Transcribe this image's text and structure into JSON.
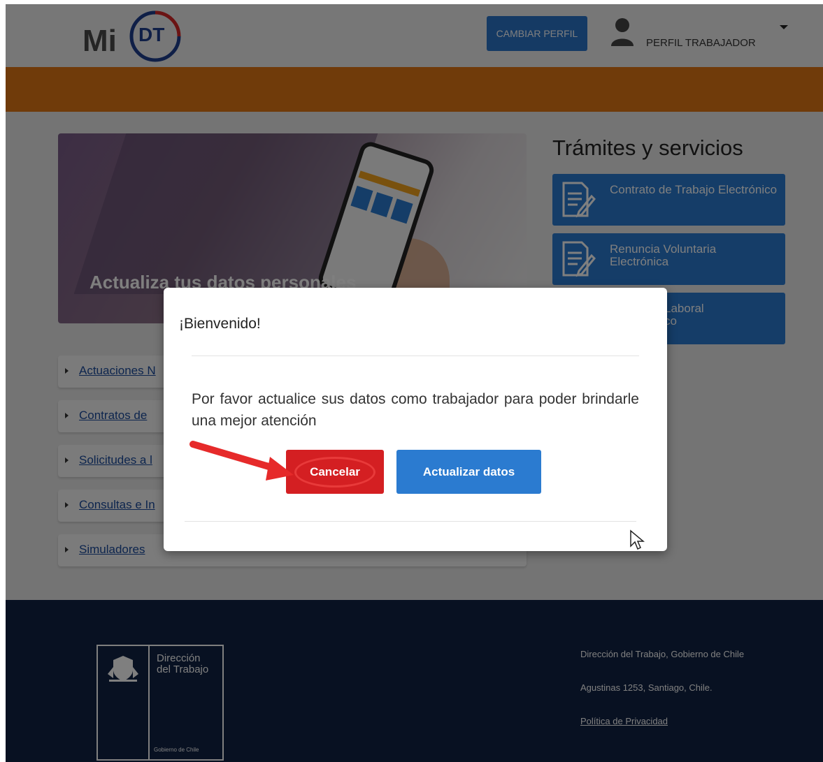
{
  "header": {
    "logo_mi": "Mi",
    "logo_dt": "DT",
    "change_profile_label": "CAMBIAR PERFIL",
    "profile_label": "PERFIL TRABAJADOR"
  },
  "hero": {
    "title": "Actualiza tus datos personales"
  },
  "links": [
    {
      "label": "Actuaciones N"
    },
    {
      "label": "Contratos de"
    },
    {
      "label": "Solicitudes a l"
    },
    {
      "label": "Consultas e In"
    },
    {
      "label": "Simuladores"
    }
  ],
  "services": {
    "title": "Trámites y servicios",
    "items": [
      {
        "label": "Contrato de Trabajo Electrónico"
      },
      {
        "label": "Renuncia Voluntaria Electrónica"
      },
      {
        "label": "Laboral\nco"
      }
    ]
  },
  "footer": {
    "logo_name": "Dirección\ndel Trabajo",
    "logo_gov": "Gobierno de Chile",
    "org": "Dirección del Trabajo, Gobierno de Chile",
    "address": "Agustinas 1253, Santiago, Chile.",
    "privacy": "Política de Privacidad"
  },
  "modal": {
    "title": "¡Bienvenido!",
    "body": "Por favor actualice sus datos como trabajador para poder brindarle una mejor atención",
    "cancel_label": "Cancelar",
    "update_label": "Actualizar datos"
  },
  "colors": {
    "brand_blue": "#2b7bd0",
    "orange": "#e07614",
    "footer_navy": "#102244",
    "cancel_red": "#d41f22",
    "link_blue": "#1a4a9c"
  },
  "icons": {
    "user": "user-icon",
    "caret": "chevron-down-icon",
    "document": "document-pen-icon",
    "arrow": "red-arrow-annotation",
    "cursor": "mouse-pointer-icon"
  }
}
